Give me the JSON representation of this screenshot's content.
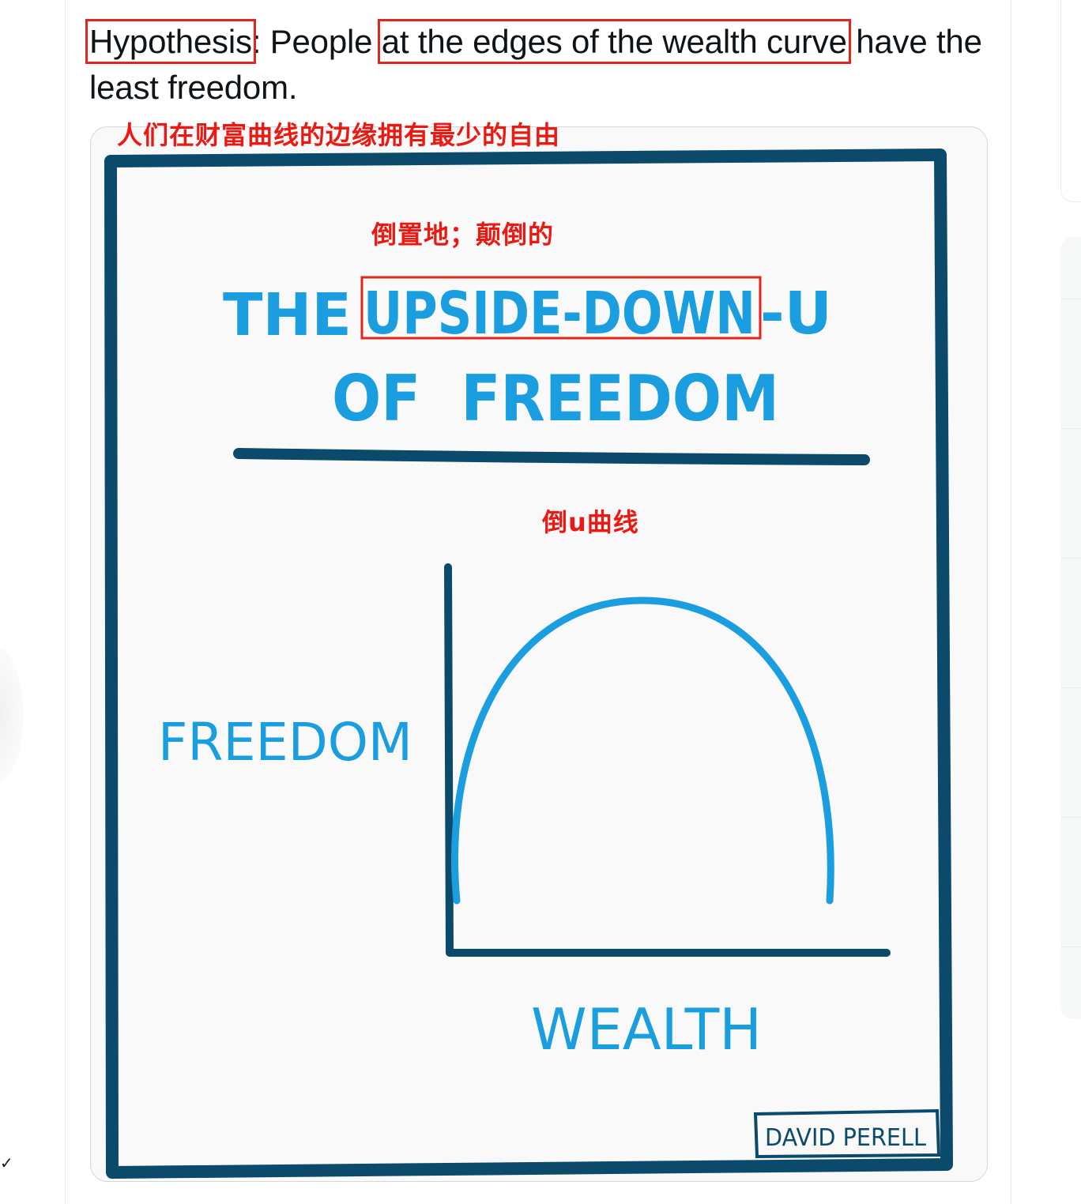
{
  "tweet": {
    "word_hypothesis": "Hypothesis",
    "text_after_hypothesis": ": People ",
    "phrase_edges": "at the edges of the wealth curve",
    "text_end": " have the least freedom."
  },
  "annotations": {
    "hypothesis_translation": "人们在财富曲线的边缘拥有最少的自由",
    "upside_down_translation": "倒置地；颠倒的",
    "curve_translation": "倒u曲线"
  },
  "sketch": {
    "title_line1_the": "THE",
    "title_line1_upside_down": "UPSIDE-DOWN",
    "title_line1_u": "-U",
    "title_line2": "OF  FREEDOM",
    "y_label": "FREEDOM",
    "x_label": "WEALTH",
    "signature": "DAVID PERELL"
  },
  "icons": {
    "check": "checkmark-icon"
  },
  "colors": {
    "text": "#0f1419",
    "annotation_red": "#e3261b",
    "sketch_dark_blue": "#0b4a6b",
    "sketch_light_blue": "#1a9ee0",
    "card_border": "#cfd9de"
  }
}
